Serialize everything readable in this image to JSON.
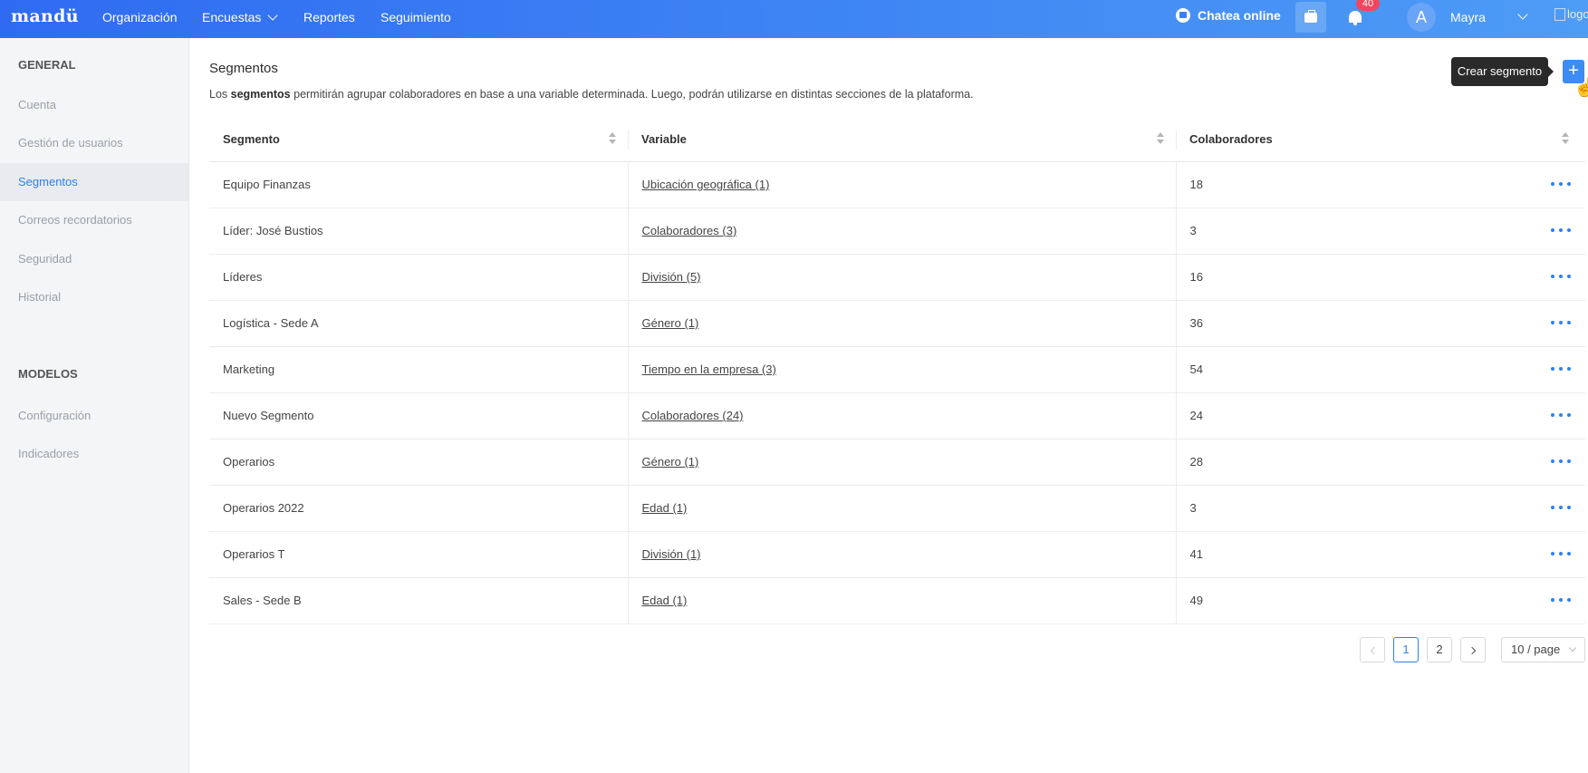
{
  "topbar": {
    "brand": "mandü",
    "nav": [
      {
        "label": "Organización"
      },
      {
        "label": "Encuestas"
      },
      {
        "label": "Reportes"
      },
      {
        "label": "Seguimiento"
      }
    ],
    "chat_label": "Chatea online",
    "notifications_count": "40",
    "avatar_initial": "A",
    "user_name": "Mayra",
    "logo_alt": "logo"
  },
  "sidebar": {
    "general_heading": "GENERAL",
    "general_items": [
      {
        "label": "Cuenta"
      },
      {
        "label": "Gestión de usuarios"
      },
      {
        "label": "Segmentos",
        "active": true
      },
      {
        "label": "Correos recordatorios"
      },
      {
        "label": "Seguridad"
      },
      {
        "label": "Historial"
      }
    ],
    "models_heading": "MODELOS",
    "models_items": [
      {
        "label": "Configuración"
      },
      {
        "label": "Indicadores"
      }
    ]
  },
  "page": {
    "title": "Segmentos",
    "desc_prefix": "Los ",
    "desc_bold": "segmentos",
    "desc_suffix": " permitirán agrupar colaboradores en base a una variable determinada. Luego, podrán utilizarse en distintas secciones de la plataforma.",
    "tooltip": "Crear segmento",
    "add_button": "+"
  },
  "table": {
    "headers": [
      "Segmento",
      "Variable",
      "Colaboradores"
    ],
    "rows": [
      {
        "segment": "Equipo Finanzas",
        "variable": "Ubicación geográfica (1)",
        "count": "18"
      },
      {
        "segment": "Líder: José Bustios",
        "variable": "Colaboradores (3)",
        "count": "3"
      },
      {
        "segment": "Líderes",
        "variable": "División (5)",
        "count": "16"
      },
      {
        "segment": "Logística - Sede A",
        "variable": "Género (1)",
        "count": "36"
      },
      {
        "segment": "Marketing",
        "variable": "Tiempo en la empresa (3)",
        "count": "54"
      },
      {
        "segment": "Nuevo Segmento",
        "variable": "Colaboradores (24)",
        "count": "24"
      },
      {
        "segment": "Operarios",
        "variable": "Género (1)",
        "count": "28"
      },
      {
        "segment": "Operarios 2022",
        "variable": "Edad (1)",
        "count": "3"
      },
      {
        "segment": "Operarios T",
        "variable": "División (1)",
        "count": "41"
      },
      {
        "segment": "Sales - Sede B",
        "variable": "Edad (1)",
        "count": "49"
      }
    ]
  },
  "pagination": {
    "pages": [
      "1",
      "2"
    ],
    "current": "1",
    "page_size": "10 / page"
  },
  "colors": {
    "primary": "#2f80ed",
    "topbar_start": "#2f6bf2",
    "topbar_end": "#4d9cf6",
    "badge": "#f5455c"
  }
}
